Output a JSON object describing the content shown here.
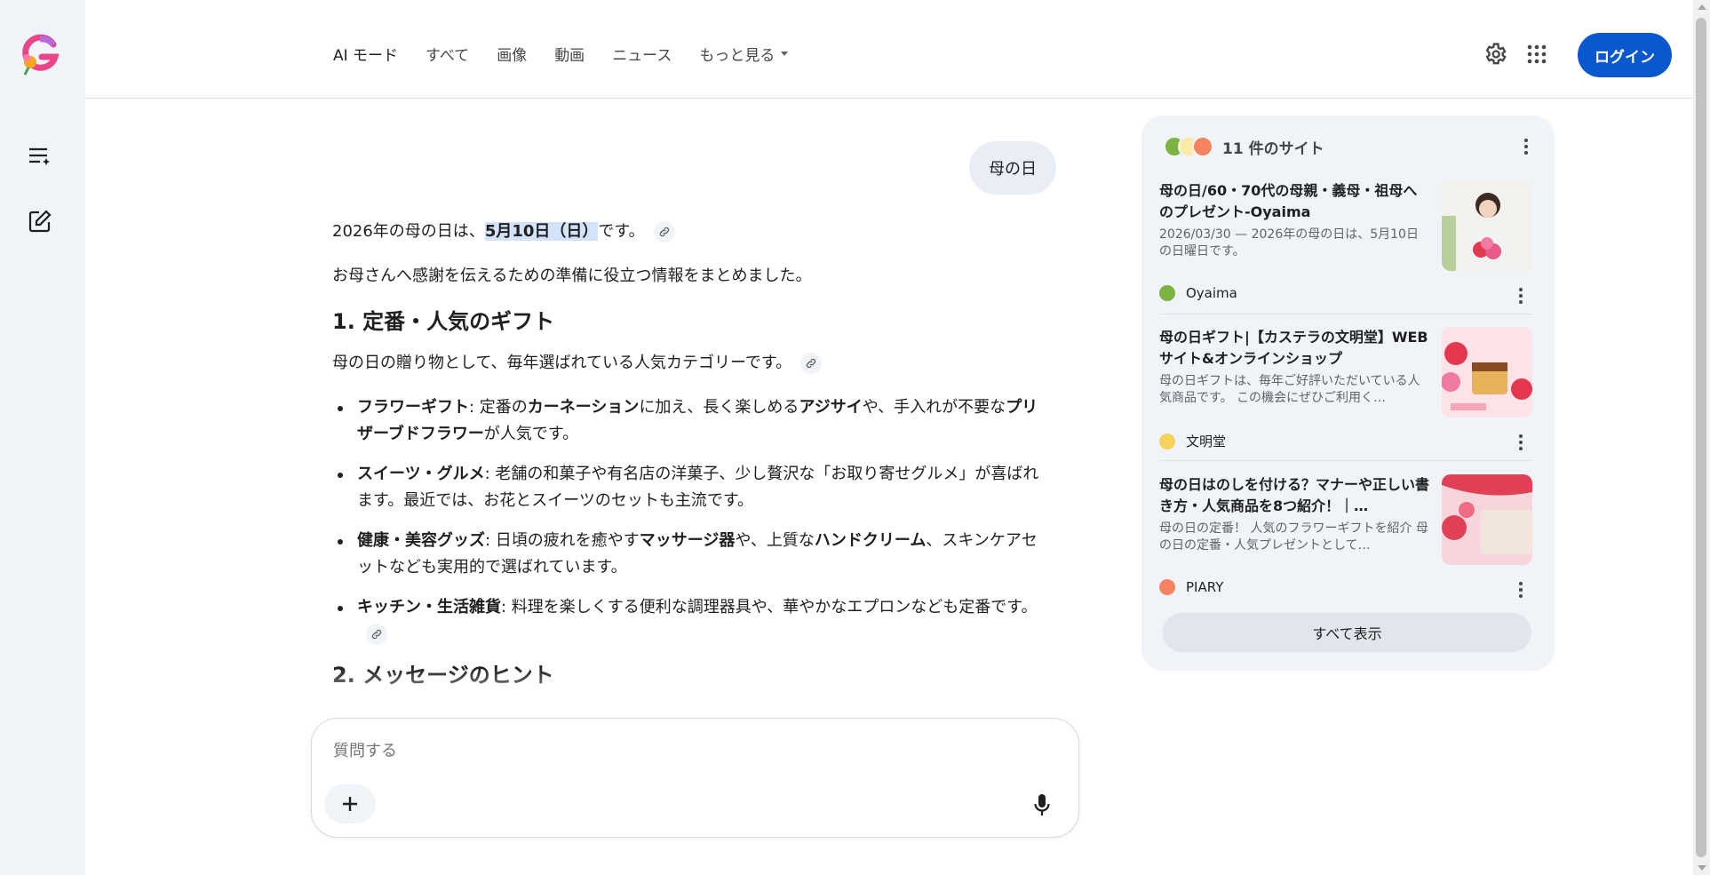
{
  "header": {
    "tabs": [
      {
        "label": "AI モード",
        "active": true
      },
      {
        "label": "すべて"
      },
      {
        "label": "画像"
      },
      {
        "label": "動画"
      },
      {
        "label": "ニュース"
      },
      {
        "label": "もっと見る"
      }
    ],
    "login_label": "ログイン"
  },
  "conversation": {
    "query": "母の日",
    "intro_prefix": "2026年の母の日は、",
    "intro_highlight": "5月10日（日）",
    "intro_suffix": "です。",
    "intro2": "お母さんへ感謝を伝えるための準備に役立つ情報をまとめました。",
    "section1_title": "1. 定番・人気のギフト",
    "section1_lead": "母の日の贈り物として、毎年選ばれている人気カテゴリーです。",
    "items": [
      {
        "t": "フラワーギフト",
        "a": ": 定番の",
        "b": "カーネーション",
        "c": "に加え、長く楽しめる",
        "d": "アジサイ",
        "e": "や、手入れが不要な",
        "f": "プリザーブドフラワー",
        "g": "が人気です。"
      },
      {
        "t": "スイーツ・グルメ",
        "a": ": 老舗の和菓子や有名店の洋菓子、少し贅沢な「お取り寄せグルメ」が喜ばれます。最近では、お花とスイーツのセットも主流です。"
      },
      {
        "t": "健康・美容グッズ",
        "a": ": 日頃の疲れを癒やす",
        "b": "マッサージ器",
        "c": "や、上質な",
        "d": "ハンドクリーム",
        "e": "、スキンケアセットなども実用的で選ばれています。"
      },
      {
        "t": "キッチン・生活雑貨",
        "a": ": 料理を楽しくする便利な調理器具や、華やかなエプロンなども定番です。"
      }
    ],
    "section2_title": "2. メッセージのヒント"
  },
  "composer": {
    "placeholder": "質問する"
  },
  "sources": {
    "count_label": "11 件のサイト",
    "cards": [
      {
        "title": "母の日/60・70代の母親・義母・祖母へのプレゼント-Oyaima",
        "snippet": "2026/03/30 — 2026年の母の日は、5月10日の日曜日です。",
        "source": "Oyaima"
      },
      {
        "title": "母の日ギフト|【カステラの文明堂】WEBサイト&オンラインショップ",
        "snippet": "母の日ギフトは、毎年ご好評いただいている人気商品です。 この機会にぜひご利用く…",
        "source": "文明堂"
      },
      {
        "title": "母の日はのしを付ける？マナーや正しい書き方・人気商品を8つ紹介！｜…",
        "snippet": "母の日の定番！ 人気のフラワーギフトを紹介 母の日の定番・人気プレゼントとして…",
        "source": "PIARY"
      }
    ],
    "show_all_label": "すべて表示"
  },
  "colors": {
    "accent": "#0b57d0",
    "rail_bg": "#f0f4f9",
    "highlight": "#d3e3fd"
  },
  "icons": [
    "google-g-logo",
    "new-chat-list-icon",
    "edit-icon",
    "link-icon",
    "settings-gear-icon",
    "apps-grid-icon",
    "plus-icon",
    "mic-icon",
    "more-vert-icon"
  ]
}
